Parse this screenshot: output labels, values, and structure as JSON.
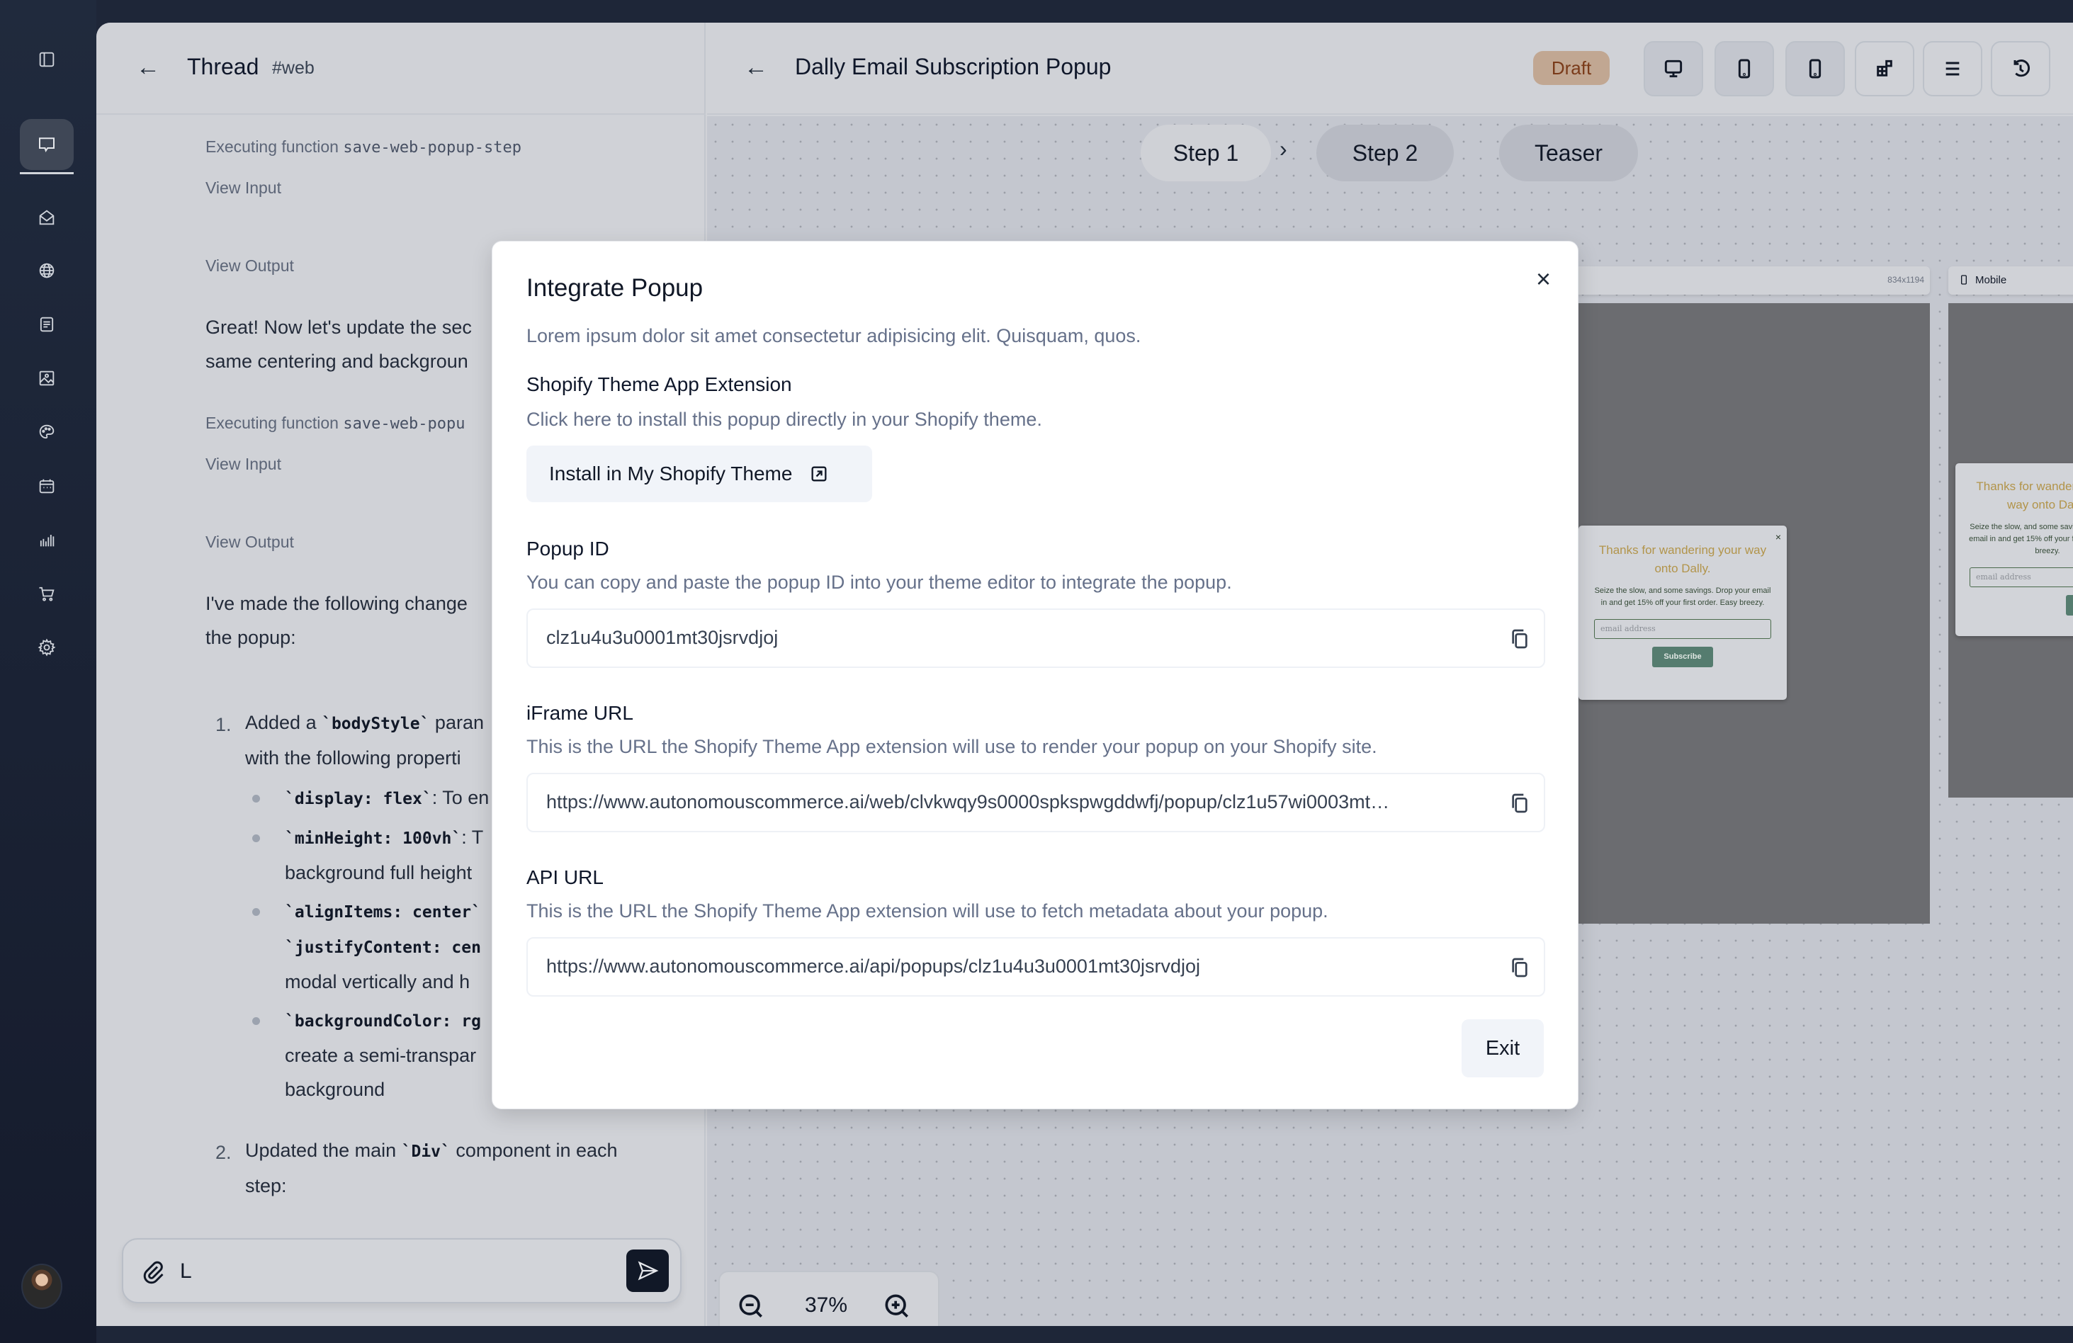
{
  "rail": {
    "items": [
      {
        "icon": "panel-toggle-icon"
      },
      {
        "icon": "chat-icon",
        "active": true
      },
      {
        "icon": "mail-icon"
      },
      {
        "icon": "globe-icon"
      },
      {
        "icon": "document-icon"
      },
      {
        "icon": "image-icon"
      },
      {
        "icon": "palette-icon"
      },
      {
        "icon": "calendar-icon"
      },
      {
        "icon": "bar-chart-icon"
      },
      {
        "icon": "cart-icon"
      },
      {
        "icon": "gear-icon"
      }
    ]
  },
  "thread": {
    "back_icon": "←",
    "title": "Thread",
    "tag": "#web",
    "messages": {
      "exec1_prefix": "Executing function ",
      "exec1_fn": "save-web-popup-step",
      "view_input_1": "View Input",
      "view_output_1": "View Output",
      "great_line1": "Great! Now let's update the sec",
      "great_line2": "same centering and backgroun",
      "exec2_prefix": "Executing function ",
      "exec2_fn": "save-web-popu",
      "view_input_2": "View Input",
      "view_output_2": "View Output",
      "changes_line1": "I've made the following change",
      "changes_line2": "the popup:",
      "item1_num": "1.",
      "item1_pre": "Added a ",
      "item1_code": "`bodyStyle`",
      "item1_post": " paran",
      "item1_line2": "with the following properti",
      "bullets": [
        {
          "code": "`display: flex`",
          "text": ": To en",
          "line2": ""
        },
        {
          "code": "`minHeight: 100vh`",
          "text": ": T",
          "line2": "background full height"
        },
        {
          "code": "`alignItems: center`",
          "text": "",
          "line2_code": "`justifyContent: cen",
          "line3": "modal vertically and h"
        },
        {
          "code": "`backgroundColor: rg",
          "text": "",
          "line2": "create a semi-transpar",
          "line3": "background"
        }
      ],
      "item2_num": "2.",
      "item2_pre": "Updated the main ",
      "item2_code": "`Div`",
      "item2_post": " component in each",
      "item2_line2": "step:"
    },
    "input_value": "L",
    "attach_icon": "paperclip-icon",
    "send_icon": "send-icon"
  },
  "editor": {
    "back_icon": "←",
    "title": "Dally Email Subscription Popup",
    "status_badge": "Draft",
    "toolbar": [
      {
        "icon": "desktop-icon",
        "label": "Desktop view"
      },
      {
        "icon": "tablet-icon",
        "label": "Tablet view"
      },
      {
        "icon": "mobile-icon",
        "label": "Mobile view"
      },
      {
        "icon": "widgets-icon",
        "label": "Components"
      },
      {
        "icon": "menu-icon",
        "label": "Menu"
      },
      {
        "icon": "history-icon",
        "label": "History"
      }
    ],
    "steps": [
      {
        "label": "Step 1",
        "active": true
      },
      {
        "label": "Step 2",
        "active": false
      },
      {
        "label": "Teaser",
        "active": false
      }
    ],
    "step_separator": "›",
    "frames": [
      {
        "label": "",
        "size": "834x1194"
      },
      {
        "label": "Mobile",
        "size": ""
      }
    ],
    "preview_popup": {
      "title": "Thanks for wandering your way onto Dally.",
      "body": "Seize the slow, and some savings. Drop your email in and get 15% off your first order. Easy breezy.",
      "email_placeholder": "email address",
      "subscribe_label": "Subscribe",
      "close": "×",
      "title_color": "#b2944a",
      "button_color": "#557c6f"
    },
    "zoom": {
      "value": "37%"
    }
  },
  "modal": {
    "title": "Integrate Popup",
    "close_icon": "×",
    "description": "Lorem ipsum dolor sit amet consectetur adipisicing elit. Quisquam, quos.",
    "shopify_section": {
      "label": "Shopify Theme App Extension",
      "description": "Click here to install this popup directly in your Shopify theme.",
      "button_label": "Install in My Shopify Theme"
    },
    "popup_id": {
      "label": "Popup ID",
      "description": "You can copy and paste the popup ID into your theme editor to integrate the popup.",
      "value": "clz1u4u3u0001mt30jsrvdjoj"
    },
    "iframe_url": {
      "label": "iFrame URL",
      "description": "This is the URL the Shopify Theme App extension will use to render your popup on your Shopify site.",
      "value": "https://www.autonomouscommerce.ai/web/clvkwqy9s0000spkspwgddwfj/popup/clz1u57wi0003mt…"
    },
    "api_url": {
      "label": "API URL",
      "description": "This is the URL the Shopify Theme App extension will use to fetch metadata about your popup.",
      "value": "https://www.autonomouscommerce.ai/api/popups/clz1u4u3u0001mt30jsrvdjoj"
    },
    "exit_label": "Exit"
  }
}
